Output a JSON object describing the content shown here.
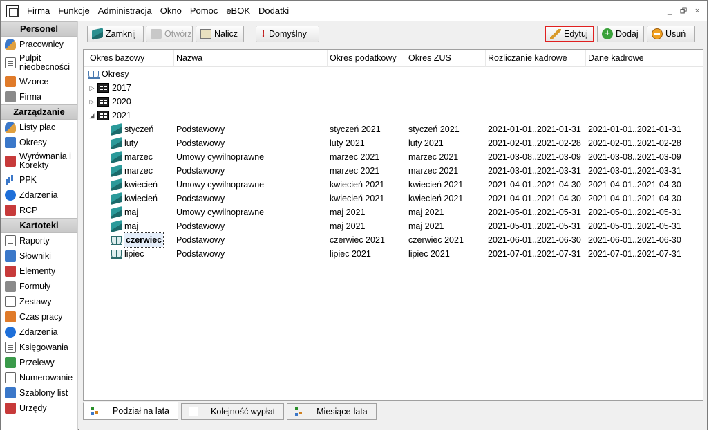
{
  "menu": [
    "Firma",
    "Funkcje",
    "Administracja",
    "Okno",
    "Pomoc",
    "eBOK",
    "Dodatki"
  ],
  "window_controls": [
    "_",
    "🗗",
    "×"
  ],
  "sidebar": {
    "sections": [
      {
        "title": "Personel",
        "items": [
          {
            "label": "Pracownicy",
            "icon": "people-icon"
          },
          {
            "label": "Pulpit nieobecności",
            "icon": "calendar-icon"
          },
          {
            "label": "Wzorce",
            "icon": "template-icon"
          },
          {
            "label": "Firma",
            "icon": "company-icon"
          }
        ]
      },
      {
        "title": "Zarządzanie",
        "items": [
          {
            "label": "Listy płac",
            "icon": "payroll-icon"
          },
          {
            "label": "Okresy",
            "icon": "periods-icon"
          },
          {
            "label": "Wyrównania i Korekty",
            "icon": "corrections-icon"
          },
          {
            "label": "PPK",
            "icon": "chart-icon"
          },
          {
            "label": "Zdarzenia",
            "icon": "info-icon"
          },
          {
            "label": "RCP",
            "icon": "clock-icon"
          }
        ]
      },
      {
        "title": "Kartoteki",
        "items": [
          {
            "label": "Raporty",
            "icon": "report-icon"
          },
          {
            "label": "Słowniki",
            "icon": "dictionary-icon"
          },
          {
            "label": "Elementy",
            "icon": "elements-icon"
          },
          {
            "label": "Formuły",
            "icon": "formula-icon"
          },
          {
            "label": "Zestawy",
            "icon": "sets-icon"
          },
          {
            "label": "Czas pracy",
            "icon": "alarm-icon"
          },
          {
            "label": "Zdarzenia",
            "icon": "info-icon"
          },
          {
            "label": "Księgowania",
            "icon": "ledger-icon"
          },
          {
            "label": "Przelewy",
            "icon": "transfer-icon"
          },
          {
            "label": "Numerowanie",
            "icon": "numbering-icon"
          },
          {
            "label": "Szablony list",
            "icon": "list-template-icon"
          },
          {
            "label": "Urzędy",
            "icon": "office-icon"
          }
        ]
      }
    ]
  },
  "toolbar": {
    "close": "Zamknij",
    "open": "Otwórz",
    "calculate": "Nalicz",
    "default": "Domyślny",
    "edit": "Edytuj",
    "add": "Dodaj",
    "delete": "Usuń"
  },
  "columns": [
    "Okres bazowy",
    "Nazwa",
    "Okres podatkowy",
    "Okres ZUS",
    "Rozliczanie kadrowe",
    "Dane kadrowe"
  ],
  "tree": {
    "root": "Okresy",
    "years": [
      {
        "label": "2017",
        "expanded": false
      },
      {
        "label": "2020",
        "expanded": false
      },
      {
        "label": "2021",
        "expanded": true
      }
    ],
    "rows": [
      {
        "base": "styczeń",
        "name": "Podstawowy",
        "tax": "styczeń 2021",
        "zus": "styczeń 2021",
        "hr": "2021-01-01..2021-01-31",
        "data": "2021-01-01..2021-01-31",
        "state": "closed"
      },
      {
        "base": "luty",
        "name": "Podstawowy",
        "tax": "luty 2021",
        "zus": "luty 2021",
        "hr": "2021-02-01..2021-02-28",
        "data": "2021-02-01..2021-02-28",
        "state": "closed"
      },
      {
        "base": "marzec",
        "name": "Umowy cywilnoprawne",
        "tax": "marzec 2021",
        "zus": "marzec 2021",
        "hr": "2021-03-08..2021-03-09",
        "data": "2021-03-08..2021-03-09",
        "state": "closed"
      },
      {
        "base": "marzec",
        "name": "Podstawowy",
        "tax": "marzec 2021",
        "zus": "marzec 2021",
        "hr": "2021-03-01..2021-03-31",
        "data": "2021-03-01..2021-03-31",
        "state": "closed"
      },
      {
        "base": "kwiecień",
        "name": "Umowy cywilnoprawne",
        "tax": "kwiecień 2021",
        "zus": "kwiecień 2021",
        "hr": "2021-04-01..2021-04-30",
        "data": "2021-04-01..2021-04-30",
        "state": "closed"
      },
      {
        "base": "kwiecień",
        "name": "Podstawowy",
        "tax": "kwiecień 2021",
        "zus": "kwiecień 2021",
        "hr": "2021-04-01..2021-04-30",
        "data": "2021-04-01..2021-04-30",
        "state": "closed"
      },
      {
        "base": "maj",
        "name": "Umowy cywilnoprawne",
        "tax": "maj 2021",
        "zus": "maj 2021",
        "hr": "2021-05-01..2021-05-31",
        "data": "2021-05-01..2021-05-31",
        "state": "closed"
      },
      {
        "base": "maj",
        "name": "Podstawowy",
        "tax": "maj 2021",
        "zus": "maj 2021",
        "hr": "2021-05-01..2021-05-31",
        "data": "2021-05-01..2021-05-31",
        "state": "closed"
      },
      {
        "base": "czerwiec",
        "name": "Podstawowy",
        "tax": "czerwiec 2021",
        "zus": "czerwiec 2021",
        "hr": "2021-06-01..2021-06-30",
        "data": "2021-06-01..2021-06-30",
        "state": "open",
        "selected": true
      },
      {
        "base": "lipiec",
        "name": "Podstawowy",
        "tax": "lipiec 2021",
        "zus": "lipiec 2021",
        "hr": "2021-07-01..2021-07-31",
        "data": "2021-07-01..2021-07-31",
        "state": "open"
      }
    ]
  },
  "tabs": [
    {
      "label": "Podział na lata",
      "active": true
    },
    {
      "label": "Kolejność wypłat",
      "active": false
    },
    {
      "label": "Miesiące-lata",
      "active": false
    }
  ],
  "colors": {
    "highlight_border": "#e02020",
    "selection_bg": "#e5eefa"
  }
}
